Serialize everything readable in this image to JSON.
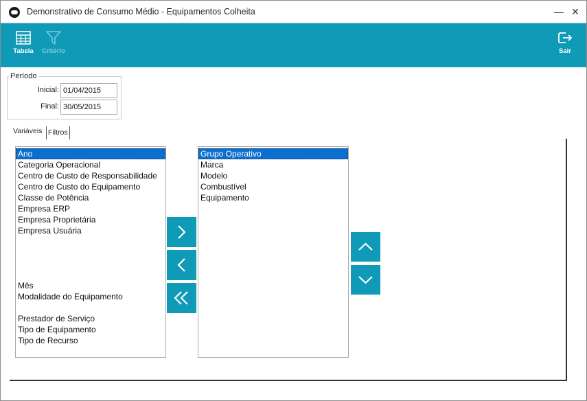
{
  "window": {
    "title": "Demonstrativo de Consumo Médio - Equipamentos Colheita",
    "minimize_glyph": "—",
    "close_glyph": "✕"
  },
  "toolbar": {
    "tabela_label": "Tabela",
    "criterio_label": "Critério",
    "sair_label": "Sair",
    "color": "#0f9ab8"
  },
  "periodo": {
    "legend": "Período",
    "inicial_label": "Inicial:",
    "inicial_value": "01/04/2015",
    "final_label": "Final:",
    "final_value": "30/05/2015"
  },
  "tabs": {
    "variaveis": "Variáveis",
    "filtros": "Filtros"
  },
  "available_list": [
    "Ano",
    "Categoria Operacional",
    "Centro de Custo de Responsabilidade",
    "Centro de Custo do Equipamento",
    "Classe de Potência",
    "Empresa ERP",
    "Empresa Proprietária",
    "Empresa Usuária",
    "",
    "",
    "",
    "",
    "Mês",
    "Modalidade do Equipamento",
    "",
    "Prestador de Serviço",
    "Tipo de Equipamento",
    "Tipo de Recurso"
  ],
  "selected_list": [
    "Grupo Operativo",
    "Marca",
    "Modelo",
    "Combustível",
    "Equipamento"
  ],
  "icons": {
    "move_right": "chevron-right-icon",
    "move_left": "chevron-left-icon",
    "move_all_left": "double-chevron-left-icon",
    "move_up": "chevron-up-icon",
    "move_down": "chevron-down-icon"
  }
}
